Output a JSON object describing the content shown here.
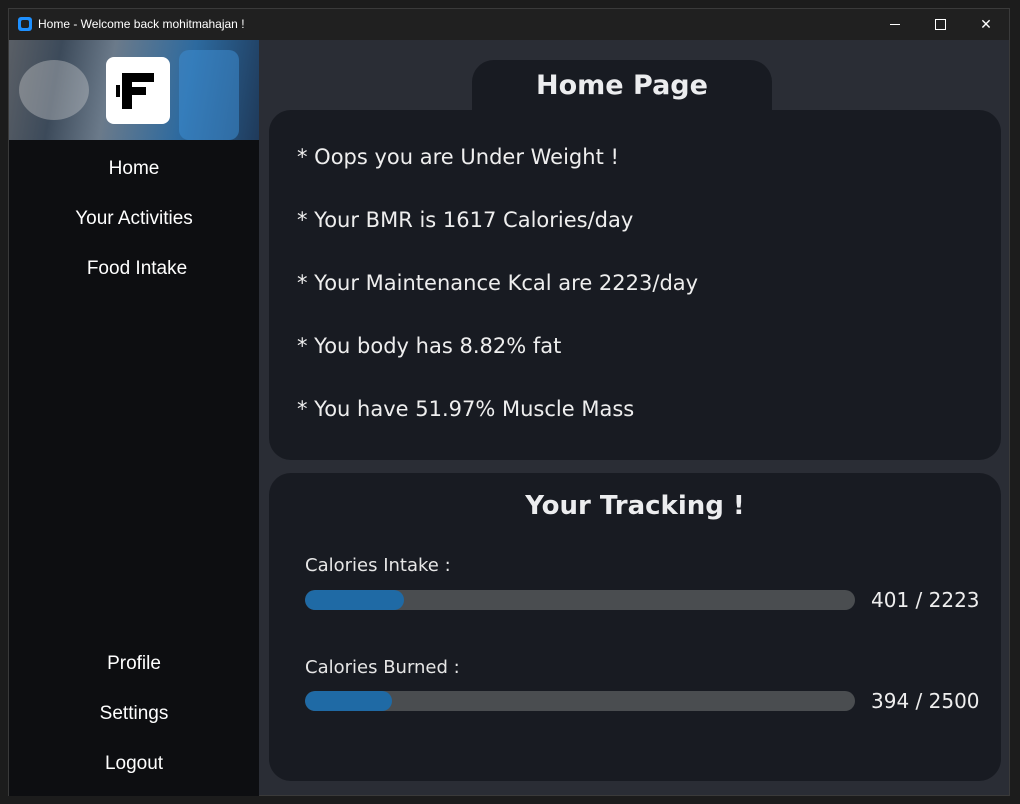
{
  "window": {
    "title": "Home - Welcome back mohitmahajan !"
  },
  "sidebar": {
    "logo": "fitness-logo-icon",
    "nav_top": [
      {
        "label": "Home"
      },
      {
        "label": "Your Activities"
      },
      {
        "label": "Food Intake"
      }
    ],
    "nav_bottom": [
      {
        "label": "Profile"
      },
      {
        "label": "Settings"
      },
      {
        "label": "Logout"
      }
    ]
  },
  "main": {
    "tab_title": "Home Page",
    "info_lines": [
      "* Oops you are Under Weight !",
      "* Your BMR is 1617 Calories/day",
      "* Your Maintenance Kcal are 2223/day",
      "* You body has 8.82% fat",
      "* You have 51.97% Muscle Mass"
    ],
    "tracking": {
      "title": "Your Tracking !",
      "items": [
        {
          "label": "Calories Intake :",
          "value_text": "401 / 2223",
          "current": 401,
          "goal": 2223
        },
        {
          "label": "Calories Burned :",
          "value_text": "394 / 2500",
          "current": 394,
          "goal": 2500
        }
      ]
    }
  },
  "colors": {
    "background": "#2a2d35",
    "card": "#181b22",
    "sidebar": "#0d0e11",
    "progress_fill": "#1f6aa5",
    "progress_track": "#4a4d50"
  }
}
